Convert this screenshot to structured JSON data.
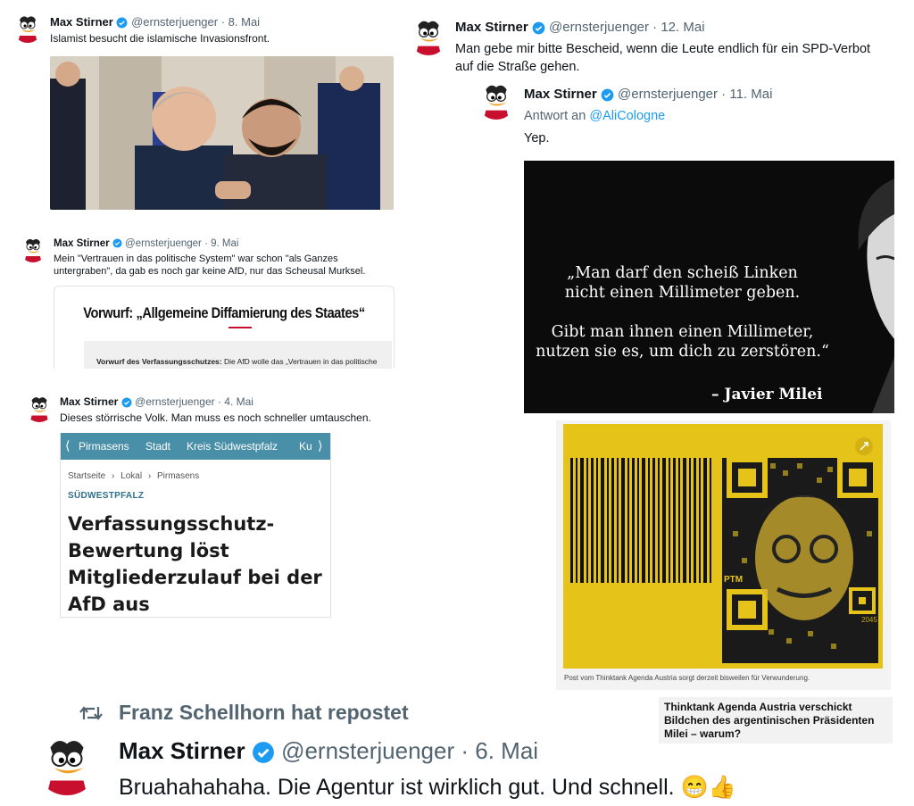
{
  "tweet1": {
    "name": "Max Stirner",
    "handle": "@ernsterjuenger",
    "date": "· 8. Mai",
    "text": "Islamist besucht die islamische Invasionsfront."
  },
  "tweet2": {
    "name": "Max Stirner",
    "handle": "@ernsterjuenger",
    "date": "· 12. Mai",
    "text_line1": "Man gebe mir bitte Bescheid, wenn die Leute endlich für ein SPD-Verbot",
    "text_line2": "auf die Straße gehen."
  },
  "reply": {
    "name": "Max Stirner",
    "handle": "@ernsterjuenger",
    "date": "· 11. Mai",
    "reply_prefix": "Antwort an",
    "reply_to": "@AliCologne",
    "text": "Yep."
  },
  "quote_image": {
    "line1": "„Man darf den scheiß Linken",
    "line2": "nicht einen Millimeter geben.",
    "line3": "Gibt man ihnen einen Millimeter,",
    "line4": "nutzen sie es, um dich zu zerstören.“",
    "author": "– Javier Milei"
  },
  "tweet3": {
    "name": "Max Stirner",
    "handle": "@ernsterjuenger",
    "date": "· 9. Mai",
    "text_line1": "Mein \"Vertrauen in das politische System\" war schon \"als Ganzes",
    "text_line2": "untergraben\", da gab es noch gar keine AfD, nur das Scheusal Murksel."
  },
  "article3": {
    "headline": "Vorwurf: „Allgemeine Diffamierung des Staates“",
    "snippet_bold": "Vorwurf des Verfassungsschutzes:",
    "snippet_rest": " Die AfD wolle das „Vertrauen in das politische"
  },
  "tweet4": {
    "name": "Max Stirner",
    "handle": "@ernsterjuenger",
    "date": "· 4. Mai",
    "text": "Dieses störrische Volk. Man muss es noch schneller umtauschen."
  },
  "news_card": {
    "nav_items": [
      "Pirmasens",
      "Stadt",
      "Kreis Südwestpfalz",
      "Ku"
    ],
    "breadcrumb": [
      "Startseite",
      "Lokal",
      "Pirmasens"
    ],
    "category": "SÜDWESTPFALZ",
    "headline_lines": [
      "Verfassungsschutz-",
      "Bewertung löst",
      "Mitgliederzulauf bei der",
      "AfD aus"
    ]
  },
  "yellow_image": {
    "barcode_label": "PTM",
    "code_number": "2045",
    "caption": "Post vom Thinktank Agenda Austria sorgt derzeit bisweilen für Verwunderung.",
    "headline": "Thinktank Agenda Austria verschickt Bildchen des argentinischen Präsidenten Milei – warum?"
  },
  "repost": {
    "label": "Franz Schellhorn hat repostet",
    "name": "Max Stirner",
    "handle": "@ernsterjuenger",
    "date": "· 6. Mai",
    "text": "Bruahahahaha. Die Agentur ist wirklich gut. Und schnell.",
    "emoji1": "😁",
    "emoji2": "👍"
  },
  "colors": {
    "verified_blue": "#1d9bf0",
    "news_teal": "#4a8fa8",
    "yellow": "#e6c319",
    "accent_red": "#c8102e"
  }
}
